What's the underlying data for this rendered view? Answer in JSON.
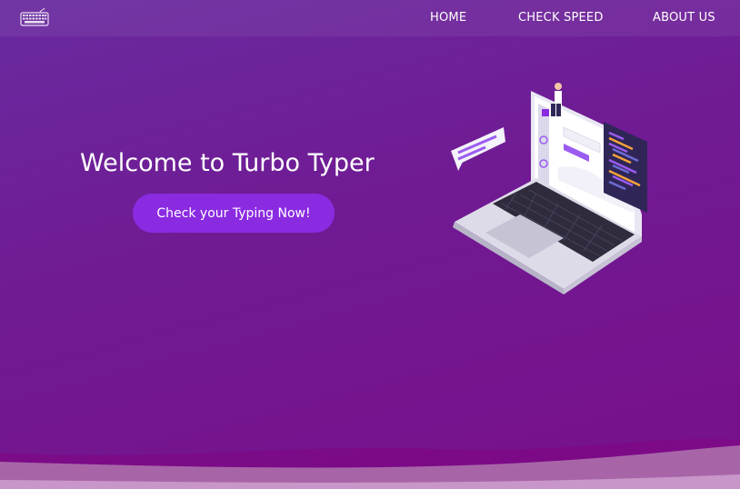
{
  "header": {
    "logo_icon": "keyboard-icon",
    "nav": [
      {
        "label": "HOME"
      },
      {
        "label": "CHECK SPEED"
      },
      {
        "label": "ABOUT US"
      }
    ]
  },
  "hero": {
    "title": "Welcome to Turbo Typer",
    "cta_label": "Check your Typing Now!",
    "illustration": "laptop-illustration"
  },
  "colors": {
    "background_top": "#6a2ba0",
    "background_bottom": "#78108a",
    "cta": "#8a2be2",
    "text": "#ffffff"
  }
}
